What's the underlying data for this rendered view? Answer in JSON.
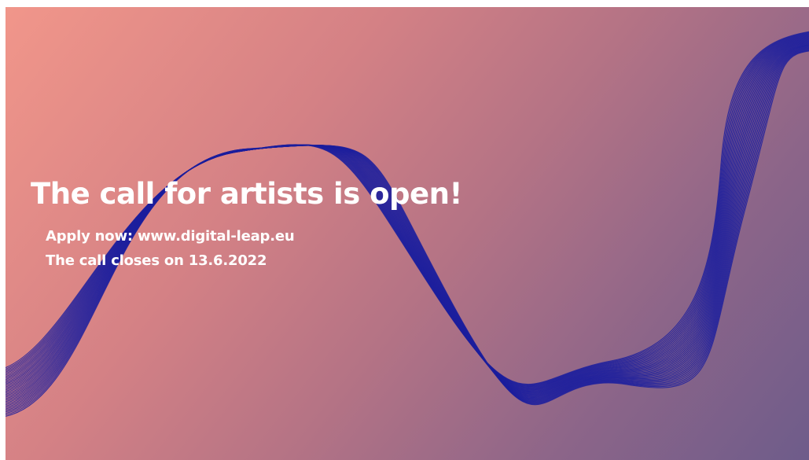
{
  "banner": {
    "headline": "The call for artists is open!",
    "apply_line": "Apply now: www.digital-leap.eu",
    "closing_line": "The call closes on 13.6.2022"
  },
  "colors": {
    "gradient_start": "#f1968a",
    "gradient_end": "#6e5c8a",
    "wave_stroke": "#1c1f9e",
    "text": "#ffffff"
  }
}
